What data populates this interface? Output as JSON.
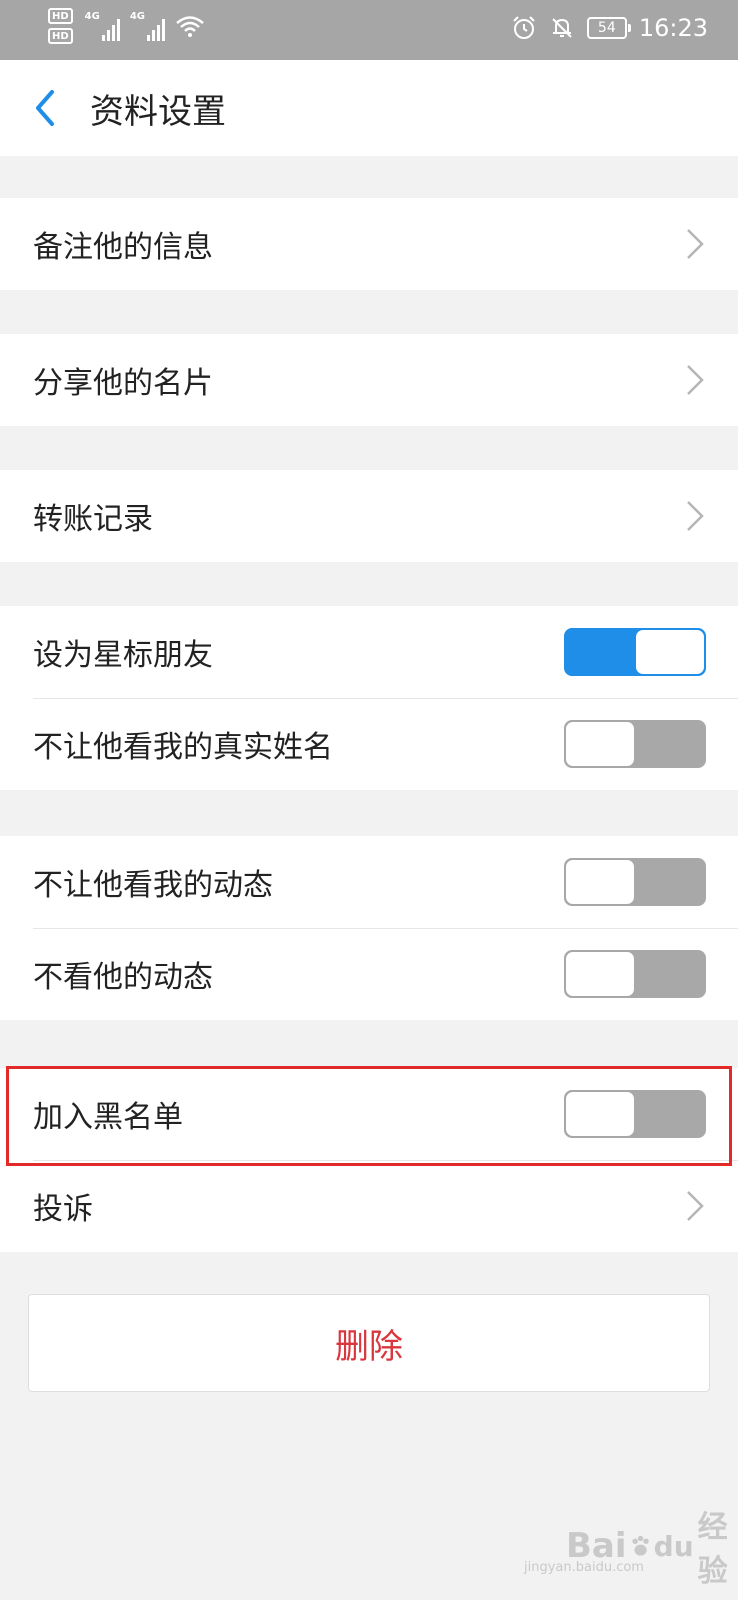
{
  "status_bar": {
    "hd_badges": [
      "HD",
      "HD"
    ],
    "network_1": "4G",
    "network_2": "4G",
    "battery": "54",
    "time": "16:23"
  },
  "header": {
    "title": "资料设置"
  },
  "rows": {
    "remark": "备注他的信息",
    "share_card": "分享他的名片",
    "transfer_records": "转账记录",
    "star_friend": "设为星标朋友",
    "hide_real_name": "不让他看我的真实姓名",
    "hide_my_moments": "不让他看我的动态",
    "hide_his_moments": "不看他的动态",
    "blacklist": "加入黑名单",
    "complain": "投诉"
  },
  "toggles": {
    "star_friend": "on",
    "hide_real_name": "off",
    "hide_my_moments": "off",
    "hide_his_moments": "off",
    "blacklist": "off"
  },
  "delete_button": {
    "label": "删除"
  },
  "watermark": {
    "text_left": "Bai",
    "text_right": "经验",
    "text_du": "du",
    "sub": "jingyan.baidu.com"
  },
  "colors": {
    "accent": "#1e8ee8",
    "danger": "#d9363e",
    "highlight": "#e22a2a",
    "background": "#f2f2f2",
    "status_bar": "#a6a6a6"
  }
}
